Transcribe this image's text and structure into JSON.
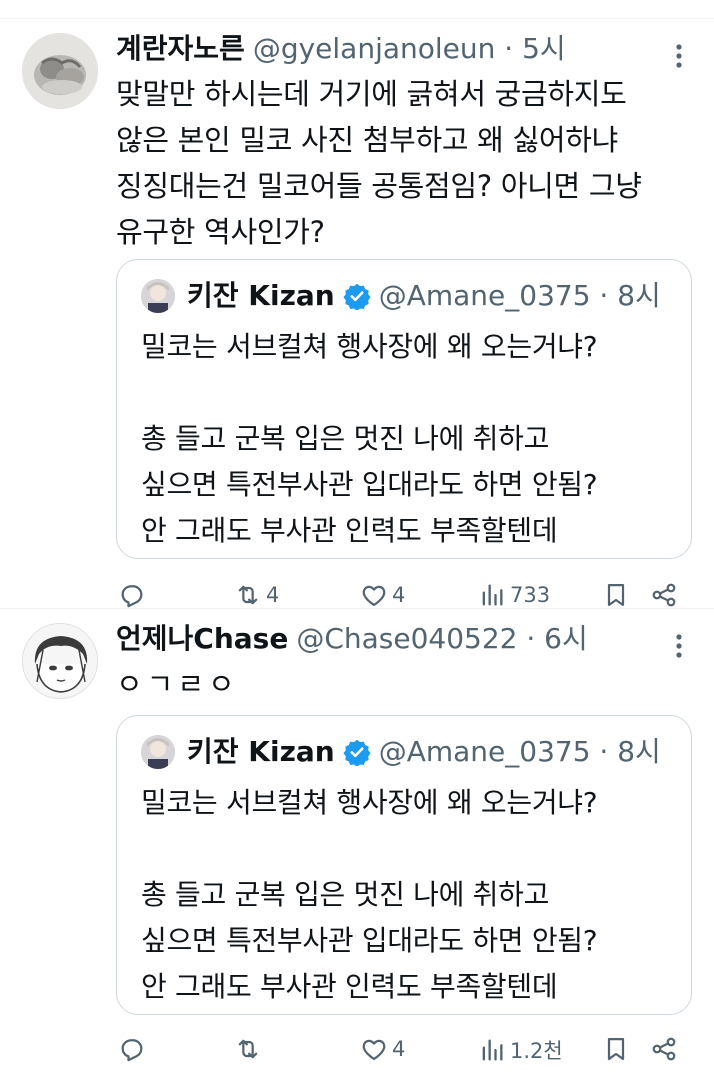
{
  "tweets": [
    {
      "name": "계란자노른",
      "meta": "@gyelanjanoleun · 5시",
      "text": "맞말만 하시는데 거기에 긁혀서 궁금하지도\n않은 본인 밀코 사진 첨부하고 왜 싫어하냐\n징징대는건 밀코어들 공통점임? 아니면 그냥\n유구한 역사인가?",
      "quote": {
        "name": "키잔 Kizan",
        "meta": "@Amane_0375 · 8시",
        "text": "밀코는 서브컬쳐 행사장에 왜 오는거냐?\n\n총 들고 군복 입은 멋진 나에 취하고\n싶으면 특전부사관 입대라도 하면 안됨?\n안 그래도 부사관 인력도 부족할텐데"
      },
      "actions": {
        "replies": "",
        "retweets": "4",
        "likes": "4",
        "views": "733"
      }
    },
    {
      "name": "언제나Chase",
      "meta": "@Chase040522 · 6시",
      "text": "ㅇㄱㄹㅇ",
      "quote": {
        "name": "키잔 Kizan",
        "meta": "@Amane_0375 · 8시",
        "text": "밀코는 서브컬쳐 행사장에 왜 오는거냐?\n\n총 들고 군복 입은 멋진 나에 취하고\n싶으면 특전부사관 입대라도 하면 안됨?\n안 그래도 부사관 인력도 부족할텐데"
      },
      "actions": {
        "replies": "",
        "retweets": "",
        "likes": "4",
        "views": "1.2천"
      }
    }
  ],
  "icons": {
    "more": "more-dots-icon",
    "reply": "reply-icon",
    "retweet": "retweet-icon",
    "like": "heart-icon",
    "views": "views-chart-icon",
    "bookmark": "bookmark-icon",
    "share": "share-icon",
    "verified": "verified-badge-icon"
  },
  "colors": {
    "text": "#0f1419",
    "secondary": "#536471",
    "verified": "#1d9bf0",
    "border": "#cfd9de"
  }
}
